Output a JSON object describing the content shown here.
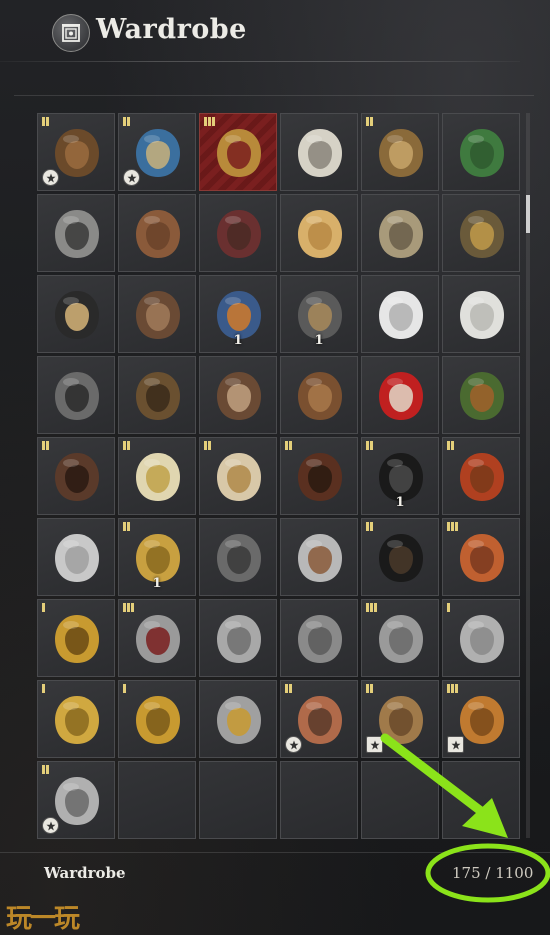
{
  "header": {
    "title": "Wardrobe",
    "icon": "wardrobe-emblem-icon"
  },
  "footer": {
    "label": "Wardrobe",
    "capacity": "175 / 1100"
  },
  "watermark": "玩一玩",
  "colors": {
    "tier_mark": "#e4cf7a",
    "annotation": "#8be31a",
    "rare_slot": "#7a1f1f"
  },
  "slots": [
    {
      "name": "padded-gambeson",
      "tier": 2,
      "count": "",
      "badge": "round"
    },
    {
      "name": "blue-tabard-coat",
      "tier": 2,
      "count": "",
      "badge": "round"
    },
    {
      "name": "golden-plate-cuirass",
      "tier": 3,
      "count": "",
      "badge": "",
      "rare": true
    },
    {
      "name": "straw-conical-hat",
      "tier": 0,
      "count": "",
      "badge": ""
    },
    {
      "name": "beaded-veil-hat",
      "tier": 2,
      "count": "",
      "badge": ""
    },
    {
      "name": "green-bucket-hat",
      "tier": 0,
      "count": "",
      "badge": ""
    },
    {
      "name": "raccoon-hood",
      "tier": 0,
      "count": "",
      "badge": ""
    },
    {
      "name": "brown-cap",
      "tier": 0,
      "count": "",
      "badge": ""
    },
    {
      "name": "fur-ushanka",
      "tier": 0,
      "count": "",
      "badge": ""
    },
    {
      "name": "wool-coif",
      "tier": 0,
      "count": "",
      "badge": ""
    },
    {
      "name": "feathered-cloak",
      "tier": 0,
      "count": "",
      "badge": ""
    },
    {
      "name": "bronze-morion",
      "tier": 0,
      "count": "",
      "badge": ""
    },
    {
      "name": "feathered-tricorn",
      "tier": 0,
      "count": "",
      "badge": ""
    },
    {
      "name": "bear-pelt-hood",
      "tier": 0,
      "count": "",
      "badge": ""
    },
    {
      "name": "blue-kepi",
      "tier": 0,
      "count": "1",
      "badge": ""
    },
    {
      "name": "woven-disc-mask",
      "tier": 0,
      "count": "1",
      "badge": ""
    },
    {
      "name": "white-wolf-hood",
      "tier": 0,
      "count": "",
      "badge": ""
    },
    {
      "name": "polar-bear-hood",
      "tier": 0,
      "count": "",
      "badge": ""
    },
    {
      "name": "grey-wolf-hood",
      "tier": 0,
      "count": "",
      "badge": ""
    },
    {
      "name": "owl-fur-hood",
      "tier": 0,
      "count": "",
      "badge": ""
    },
    {
      "name": "deer-head-hood",
      "tier": 0,
      "count": "",
      "badge": ""
    },
    {
      "name": "brown-bear-hood",
      "tier": 0,
      "count": "",
      "badge": ""
    },
    {
      "name": "red-hood",
      "tier": 0,
      "count": "",
      "badge": ""
    },
    {
      "name": "leaf-mask-headdress",
      "tier": 0,
      "count": "",
      "badge": ""
    },
    {
      "name": "stag-head-hood",
      "tier": 2,
      "count": "",
      "badge": ""
    },
    {
      "name": "gold-trim-cap",
      "tier": 2,
      "count": "",
      "badge": ""
    },
    {
      "name": "eagle-feather-helm",
      "tier": 2,
      "count": "",
      "badge": ""
    },
    {
      "name": "oni-mask",
      "tier": 2,
      "count": "",
      "badge": ""
    },
    {
      "name": "black-crown-helm",
      "tier": 2,
      "count": "1",
      "badge": ""
    },
    {
      "name": "red-plumed-helm",
      "tier": 2,
      "count": "",
      "badge": ""
    },
    {
      "name": "steel-nasal-helm",
      "tier": 0,
      "count": "",
      "badge": ""
    },
    {
      "name": "gilded-bird-helm",
      "tier": 2,
      "count": "1",
      "badge": ""
    },
    {
      "name": "horned-visor-helm",
      "tier": 0,
      "count": "",
      "badge": ""
    },
    {
      "name": "spired-kettle-helm",
      "tier": 0,
      "count": "",
      "badge": ""
    },
    {
      "name": "crow-feather-hood",
      "tier": 2,
      "count": "",
      "badge": ""
    },
    {
      "name": "red-plume-face-helm",
      "tier": 3,
      "count": "",
      "badge": ""
    },
    {
      "name": "golden-lion-helm",
      "tier": 1,
      "count": "",
      "badge": ""
    },
    {
      "name": "crested-close-helm",
      "tier": 3,
      "count": "",
      "badge": ""
    },
    {
      "name": "steel-sallet",
      "tier": 0,
      "count": "",
      "badge": ""
    },
    {
      "name": "iron-kettle-hat",
      "tier": 0,
      "count": "",
      "badge": ""
    },
    {
      "name": "great-helm",
      "tier": 3,
      "count": "",
      "badge": ""
    },
    {
      "name": "wide-brim-kettle",
      "tier": 1,
      "count": "",
      "badge": ""
    },
    {
      "name": "gold-bascinet",
      "tier": 1,
      "count": "",
      "badge": ""
    },
    {
      "name": "gold-barbute",
      "tier": 1,
      "count": "",
      "badge": ""
    },
    {
      "name": "steel-morion",
      "tier": 0,
      "count": "",
      "badge": ""
    },
    {
      "name": "ornate-mail-helm",
      "tier": 2,
      "count": "",
      "badge": "round"
    },
    {
      "name": "engraved-spike-helm",
      "tier": 2,
      "count": "",
      "badge": "square"
    },
    {
      "name": "horned-bronze-helm",
      "tier": 3,
      "count": "",
      "badge": "square"
    },
    {
      "name": "plumed-armet",
      "tier": 2,
      "count": "",
      "badge": "round"
    },
    {
      "name": "empty",
      "tier": 0,
      "count": "",
      "badge": "",
      "empty": true
    },
    {
      "name": "empty",
      "tier": 0,
      "count": "",
      "badge": "",
      "empty": true
    },
    {
      "name": "empty",
      "tier": 0,
      "count": "",
      "badge": "",
      "empty": true
    },
    {
      "name": "empty",
      "tier": 0,
      "count": "",
      "badge": "",
      "empty": true
    },
    {
      "name": "empty",
      "tier": 0,
      "count": "",
      "badge": "",
      "empty": true
    }
  ]
}
